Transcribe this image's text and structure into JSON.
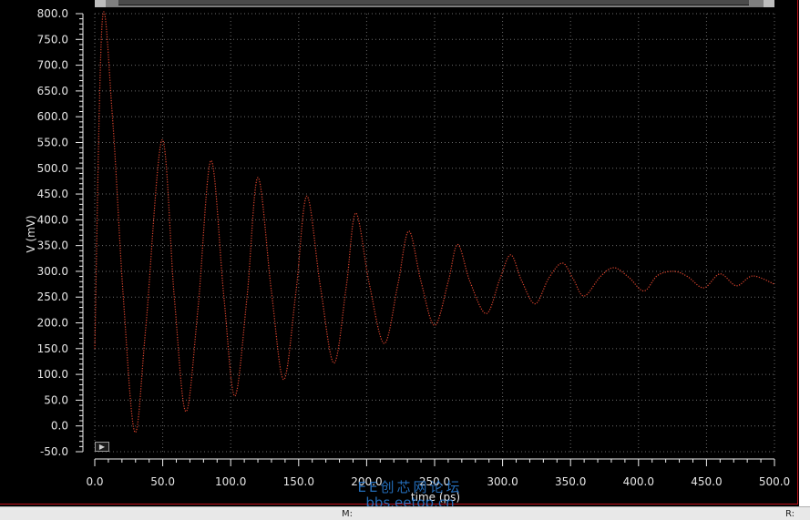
{
  "chart_data": {
    "type": "line",
    "title": "",
    "xlabel": "time (ps)",
    "ylabel": "V (mV)",
    "xlim": [
      0,
      500
    ],
    "ylim": [
      -50,
      800
    ],
    "x_ticks": [
      "0.0",
      "50.0",
      "100.0",
      "150.0",
      "200.0",
      "250.0",
      "300.0",
      "350.0",
      "400.0",
      "450.0",
      "500.0"
    ],
    "y_ticks": [
      "-50.0",
      "0.0",
      "50.0",
      "100.0",
      "150.0",
      "200.0",
      "250.0",
      "300.0",
      "350.0",
      "400.0",
      "450.0",
      "500.0",
      "550.0",
      "600.0",
      "650.0",
      "700.0",
      "750.0",
      "800.0"
    ],
    "grid": true,
    "legend": "none",
    "series": [
      {
        "color": "#e0452e",
        "line_style": "dotted",
        "x": [
          0,
          5.5,
          13,
          21,
          29.5,
          37.5,
          49.5,
          58.5,
          67,
          76,
          85.5,
          95,
          103,
          112,
          120,
          130,
          139,
          148,
          156,
          166,
          176,
          185,
          192,
          202,
          213,
          223,
          231,
          240,
          250,
          260,
          267,
          276,
          288,
          298,
          306,
          314,
          324,
          334,
          344,
          352,
          360,
          372,
          382,
          393,
          404,
          414,
          426,
          436,
          448,
          460,
          472,
          484,
          500
        ],
        "y": [
          150,
          785,
          600,
          250,
          -12,
          190,
          555,
          250,
          28,
          230,
          515,
          250,
          58,
          250,
          482,
          260,
          90,
          260,
          446,
          270,
          122,
          270,
          413,
          275,
          160,
          275,
          378,
          280,
          195,
          280,
          352,
          280,
          218,
          285,
          332,
          282,
          237,
          287,
          316,
          285,
          252,
          290,
          307,
          288,
          262,
          292,
          300,
          290,
          268,
          295,
          272,
          291,
          275
        ]
      }
    ]
  },
  "controls": {
    "play_glyph": "▶"
  },
  "status_bar": {
    "m_label": "M:",
    "r_label": "R:"
  },
  "watermark": {
    "line1": "EE创芯网论坛",
    "line2": "bbs.eetop.cn"
  },
  "colors": {
    "background": "#000000",
    "grid": "#6b6b6b",
    "trace": "#e0452e",
    "frame": "#c0101a"
  }
}
